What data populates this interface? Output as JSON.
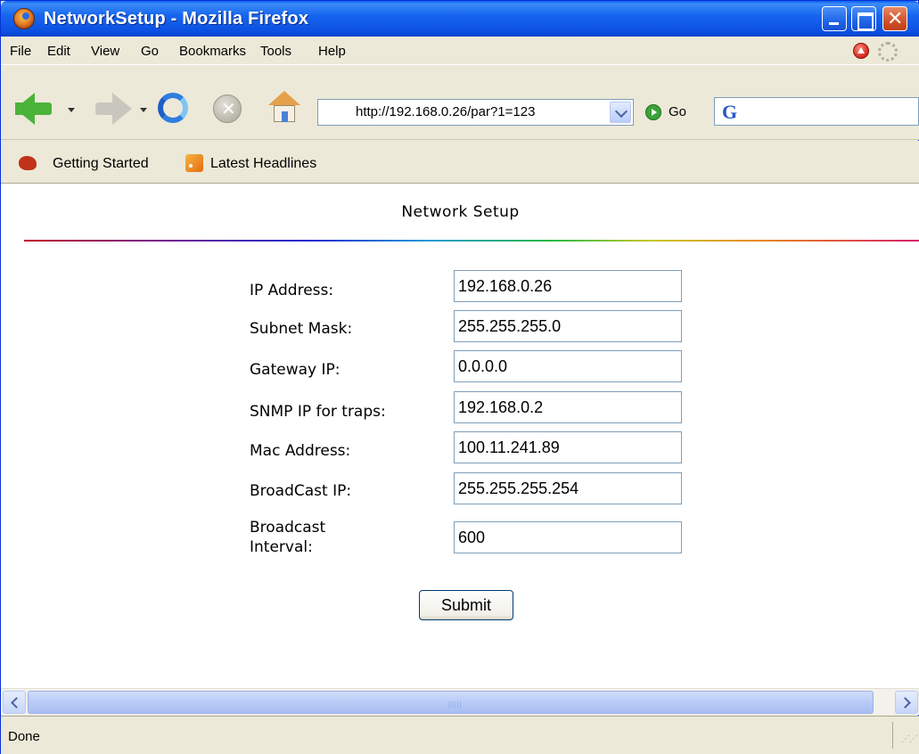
{
  "window": {
    "title": "NetworkSetup - Mozilla Firefox"
  },
  "menu": {
    "items": [
      "File",
      "Edit",
      "View",
      "Go",
      "Bookmarks",
      "Tools",
      "Help"
    ]
  },
  "navigation": {
    "url": "http://192.168.0.26/par?1=123",
    "go_label": "Go",
    "search_value": ""
  },
  "bookmarks": {
    "items": [
      "Getting Started",
      "Latest Headlines"
    ]
  },
  "page": {
    "title": "Network Setup",
    "fields": [
      {
        "label": "IP Address:",
        "value": "192.168.0.26"
      },
      {
        "label": "Subnet Mask:",
        "value": "255.255.255.0"
      },
      {
        "label": "Gateway IP:",
        "value": "0.0.0.0"
      },
      {
        "label": "SNMP IP for traps:",
        "value": "192.168.0.2"
      },
      {
        "label": "Mac Address:",
        "value": "100.11.241.89"
      },
      {
        "label": "BroadCast IP:",
        "value": "255.255.255.254"
      },
      {
        "label": "Broadcast Interval:",
        "value": "600"
      }
    ],
    "submit_label": "Submit"
  },
  "status": {
    "text": "Done"
  },
  "colors": {
    "title_bar": "#1766ef",
    "chrome": "#ece9d8",
    "content_bg": "#ffffff"
  },
  "icons": [
    "firefox-icon",
    "back-arrow-icon",
    "forward-arrow-icon",
    "reload-icon",
    "stop-icon",
    "home-icon",
    "go-icon",
    "google-icon",
    "firefox-bookmark-icon",
    "rss-icon"
  ]
}
